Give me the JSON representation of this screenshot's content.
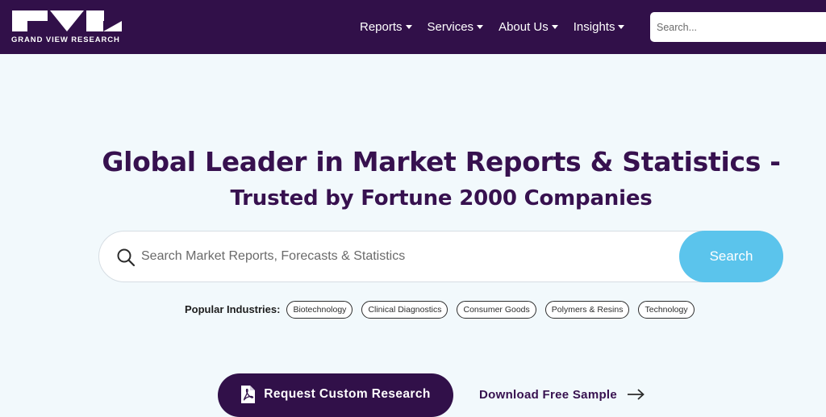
{
  "brand": {
    "name": "GRAND VIEW RESEARCH",
    "colors": {
      "navbar": "#311049",
      "accent": "#5bc4ec",
      "heading": "#37114f"
    }
  },
  "nav": {
    "items": [
      {
        "label": "Reports",
        "icon": "caret-down-icon"
      },
      {
        "label": "Services",
        "icon": "caret-down-icon"
      },
      {
        "label": "About Us",
        "icon": "caret-down-icon"
      },
      {
        "label": "Insights",
        "icon": "caret-down-icon"
      }
    ],
    "search_placeholder": "Search..."
  },
  "hero": {
    "headline": "Global Leader in Market Reports & Statistics -",
    "subheadline": "Trusted by Fortune 2000 Companies",
    "search": {
      "icon": "search-icon",
      "placeholder": "Search Market Reports, Forecasts & Statistics",
      "button_label": "Search"
    },
    "popular": {
      "label": "Popular Industries:",
      "chips": [
        "Biotechnology",
        "Clinical Diagnostics",
        "Consumer Goods",
        "Polymers & Resins",
        "Technology"
      ]
    }
  },
  "cta": {
    "primary_label": "Request Custom Research",
    "primary_icon": "pdf-icon",
    "secondary_label": "Download Free Sample",
    "secondary_icon": "arrow-right-icon"
  }
}
